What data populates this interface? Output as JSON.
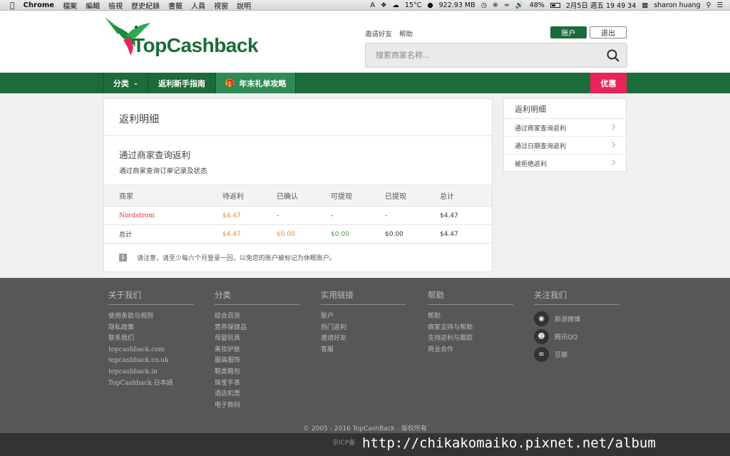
{
  "menubar": {
    "app": "Chrome",
    "menus": [
      "檔案",
      "編輯",
      "檢視",
      "歷史紀錄",
      "書籤",
      "人員",
      "視窗",
      "說明"
    ],
    "weather": "15°C",
    "memory": "922.93 MB",
    "battery": "48%",
    "datetime": "2月5日 週五 19 49 34",
    "user": "sharon huang"
  },
  "header": {
    "logo_text": "TopCashback",
    "invite": "邀请好友",
    "help": "帮助",
    "account_btn": "账户",
    "logout_btn": "退出",
    "search_placeholder": "搜索商家名称..."
  },
  "nav": {
    "category": "分类",
    "guide": "返利新手指南",
    "gift": "年末礼单攻略",
    "deals": "优惠"
  },
  "main": {
    "title": "返利明细",
    "subtitle": "通过商家查询返利",
    "description": "通过商家查询订单记录及状态",
    "columns": [
      "商家",
      "待返利",
      "已确认",
      "可提现",
      "已提现",
      "总计"
    ],
    "rows": [
      [
        "Nordstrom",
        "$4.47",
        "-",
        "-",
        "-",
        "$4.47"
      ]
    ],
    "total": [
      "总计",
      "$4.47",
      "$0.00",
      "$0.00",
      "$0.00",
      "$4.47"
    ],
    "note": "请注意，请至少每六个月登录一回，以免您的账户被标记为休眠账户。"
  },
  "side": {
    "title": "返利明细",
    "items": [
      "通过商家查询返利",
      "通过日期查询返利",
      "被拒绝返利"
    ]
  },
  "footer": {
    "about": {
      "title": "关于我们",
      "links": [
        "使用条款与规则",
        "隐私政策",
        "联系我们",
        "topcashback.com",
        "topcashback.co.uk",
        "topcashback.in",
        "TopCashback 日本語"
      ]
    },
    "categories": {
      "title": "分类",
      "links": [
        "综合百货",
        "营养保健品",
        "母婴玩具",
        "美妆护肤",
        "服装服饰",
        "鞋类箱包",
        "珠宝手表",
        "酒店机票",
        "电子数码"
      ]
    },
    "useful": {
      "title": "实用链接",
      "links": [
        "账户",
        "热门返利",
        "邀请好友",
        "客服"
      ]
    },
    "help": {
      "title": "帮助",
      "links": [
        "帮助",
        "商家支持与帮助",
        "支持返利与跟踪",
        "商业合作"
      ]
    },
    "follow": {
      "title": "关注我们",
      "links": [
        "新浪微博",
        "腾讯QQ",
        "豆瓣"
      ]
    },
    "copyright": "© 2005 - 2016 TopCashBack - 版权所有",
    "icp": "京ICP备"
  },
  "watermark": "http://chikakomaiko.pixnet.net/album",
  "colors": {
    "brand_green": "#1c6b3a",
    "deal_pink": "#e8245b",
    "pending_orange": "#f08a24",
    "available_green": "#3aa33a"
  }
}
